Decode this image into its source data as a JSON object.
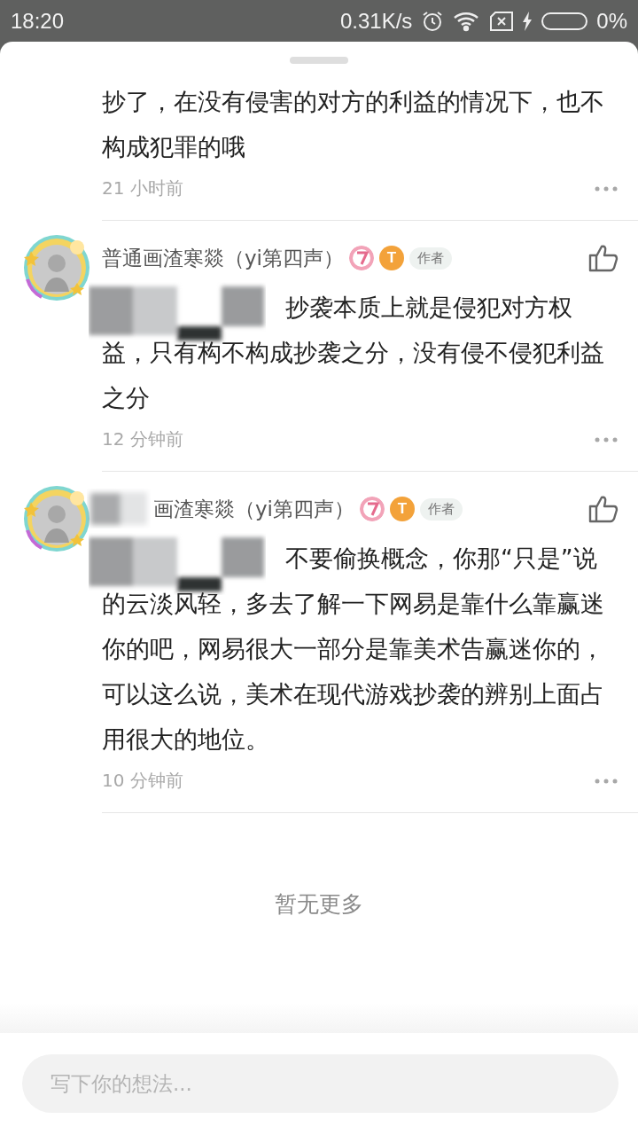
{
  "status_bar": {
    "time": "18:20",
    "network_speed": "0.31K/s",
    "battery_percent": "0%",
    "charging": true
  },
  "comments": [
    {
      "kind": "continuation",
      "text": "抄了，在没有侵害的对方的利益的情况下，也不构成犯罪的哦",
      "time": "21 小时前"
    },
    {
      "kind": "comment",
      "username": "普通画渣寒燚（yi第四声）",
      "username_redacted": false,
      "badge_letter": "T",
      "author_tag": "作者",
      "text": "抄袭本质上就是侵犯对方权益，只有构不构成抄袭之分，没有侵不侵犯利益之分",
      "text_redacted": true,
      "time": "12 分钟前"
    },
    {
      "kind": "comment",
      "username": "画渣寒燚（yi第四声）",
      "username_redacted": true,
      "badge_letter": "T",
      "author_tag": "作者",
      "text": "不要偷换概念，你那“只是”说的云淡风轻，多去了解一下网易是靠什么靠赢迷你的吧，网易很大一部分是靠美术告赢迷你的，可以这么说，美术在现代游戏抄袭的辨别上面占用很大的地位。",
      "text_redacted": true,
      "time": "10 分钟前"
    }
  ],
  "end_text": "暂无更多",
  "input": {
    "placeholder": "写下你的想法..."
  }
}
